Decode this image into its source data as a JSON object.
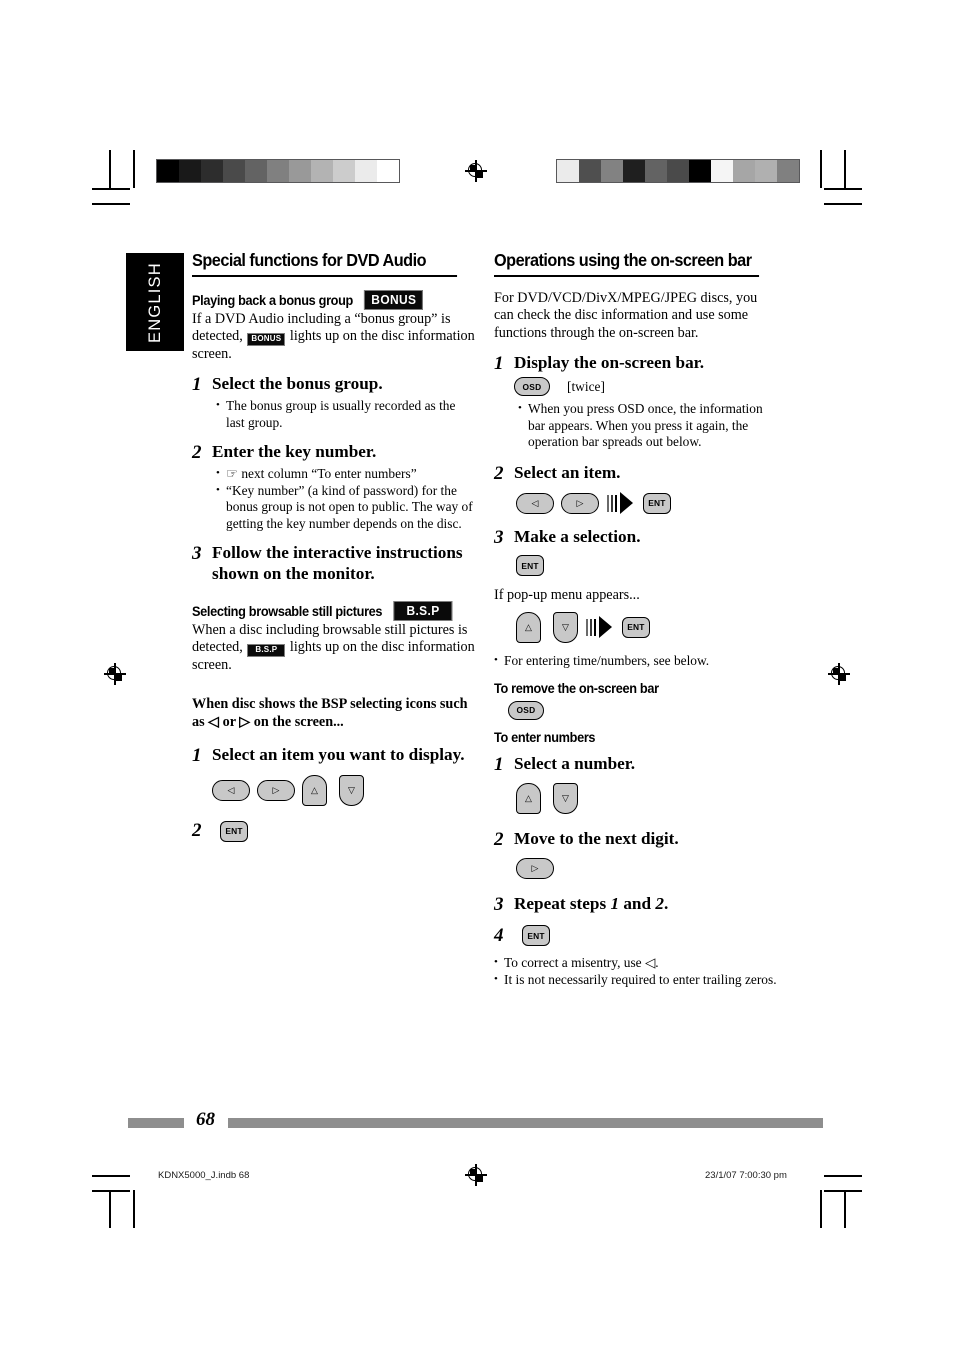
{
  "language_tab": "ENGLISH",
  "left_column": {
    "section_title": "Special functions for DVD Audio",
    "bonus": {
      "heading": "Playing back a bonus group",
      "badge": "BONUS",
      "intro_a": "If a DVD Audio including a “bonus group” is detected, ",
      "intro_badge": "BONUS",
      "intro_b": " lights up on the disc information screen.",
      "steps": [
        {
          "num": "1",
          "text": "Select the bonus group.",
          "bullets": [
            "The bonus group is usually recorded as the last group."
          ]
        },
        {
          "num": "2",
          "text": "Enter the key number.",
          "bullets": [
            "☞ next column “To enter numbers”",
            "“Key number” (a kind of password) for the bonus group is not open to public. The way of getting the key number depends on the disc."
          ]
        },
        {
          "num": "3",
          "text": "Follow the interactive instructions shown on the monitor.",
          "bullets": []
        }
      ]
    },
    "bsp": {
      "heading": "Selecting browsable still pictures",
      "badge": "B.S.P",
      "intro_a": "When a disc including browsable still pictures is detected, ",
      "intro_badge": "B.S.P",
      "intro_b": " lights up on the disc information screen.",
      "note": "When disc shows the BSP selecting icons such as ◁ or ▷ on the screen...",
      "step1": {
        "num": "1",
        "text": "Select an item you want to display."
      },
      "step1_keys": [
        "left-key",
        "right-key",
        "up-key",
        "down-key"
      ],
      "step2": {
        "num": "2"
      },
      "step2_keys": [
        "ent-key"
      ]
    }
  },
  "right_column": {
    "section_title": "Operations using the on-screen bar",
    "intro": "For DVD/VCD/DivX/MPEG/JPEG discs, you can check the disc information and use some functions through the on-screen bar.",
    "step1": {
      "num": "1",
      "text": "Display the on-screen bar.",
      "key": "OSD",
      "key_suffix": "[twice]",
      "bullets": [
        "When you press OSD once, the information bar appears. When you press it again, the operation bar spreads out below."
      ]
    },
    "step2": {
      "num": "2",
      "text": "Select an item.",
      "keys": [
        "left-key",
        "right-key",
        "arrow-separator",
        "ent-key"
      ]
    },
    "step3": {
      "num": "3",
      "text": "Make a selection.",
      "keys": [
        "ent-key"
      ],
      "popup_note": "If pop-up menu appears...",
      "popup_keys": [
        "up-key",
        "down-key",
        "arrow-separator",
        "ent-key"
      ],
      "bullets": [
        "For entering time/numbers, see below."
      ]
    },
    "remove_bar": {
      "heading": "To remove the on-screen bar",
      "key": "OSD"
    },
    "enter_numbers": {
      "heading": "To enter numbers",
      "steps": [
        {
          "num": "1",
          "text": "Select a number.",
          "keys": [
            "up-key",
            "down-key"
          ]
        },
        {
          "num": "2",
          "text": "Move to the next digit.",
          "keys": [
            "right-key"
          ]
        },
        {
          "num": "3",
          "text_pre": "Repeat steps ",
          "text_n1": "1",
          "text_mid": " and ",
          "text_n2": "2",
          "text_post": "."
        },
        {
          "num": "4",
          "keys": [
            "ent-key"
          ]
        }
      ],
      "bullets": [
        "To correct a misentry, use ◁.",
        "It is not necessarily required to enter trailing zeros."
      ]
    }
  },
  "key_labels": {
    "ent": "ENT",
    "osd": "OSD",
    "left": "◁",
    "right": "▷",
    "up": "△",
    "down": "▽"
  },
  "footer": {
    "page_number": "68",
    "file_name": "KDNX5000_J.indb   68",
    "timestamp": "23/1/07   7:00:30 pm"
  },
  "calibration": {
    "left_swatches": [
      "#000000",
      "#191919",
      "#2d2d2d",
      "#4a4a4a",
      "#636363",
      "#808080",
      "#999999",
      "#b3b3b3",
      "#cccccc",
      "#ebebeb",
      "#ffffff"
    ],
    "right_swatches": [
      "#ebebeb",
      "#4f4f4f",
      "#828282",
      "#1f1f1f",
      "#636363",
      "#4a4a4a",
      "#000000",
      "#f5f5f5",
      "#a6a6a6",
      "#b0b0b0",
      "#808080"
    ]
  }
}
